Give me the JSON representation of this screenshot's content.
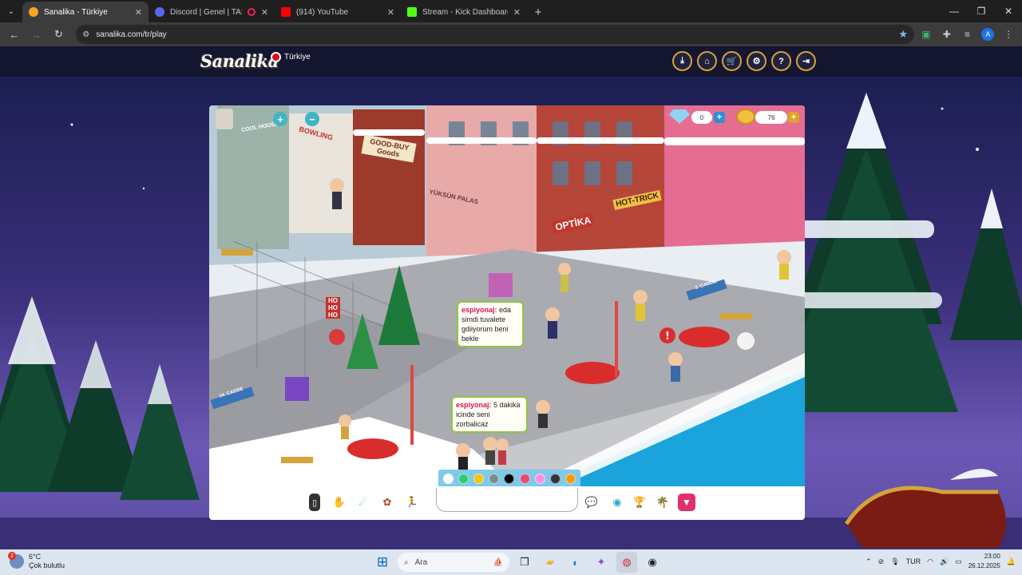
{
  "browser": {
    "tabs": [
      {
        "title": "Sanalika - Türkiye",
        "active": true,
        "fav_color": "#f6a623"
      },
      {
        "title": "Discord | Genel | TAŞACAK",
        "active": false,
        "fav_color": "#5865f2"
      },
      {
        "title": "(914) YouTube",
        "active": false,
        "fav_color": "#ff0000"
      },
      {
        "title": "Stream - Kick Dashboard",
        "active": false,
        "fav_color": "#53fc18"
      }
    ],
    "new_tab": "+",
    "url": "sanalika.com/tr/play",
    "profile_initial": "A"
  },
  "site": {
    "logo": "Sanalika",
    "region": "Türkiye",
    "header_icons": [
      "download-icon",
      "home-icon",
      "cart-icon",
      "gear-icon",
      "help-icon",
      "logout-icon"
    ],
    "header_glyphs": [
      "⤓",
      "⌂",
      "🛒",
      "⚙",
      "?",
      "⇥"
    ]
  },
  "game": {
    "diamonds": "0",
    "gold": "76",
    "plus": "+",
    "minus": "−",
    "signs": {
      "cool_house": "COOL HOUSE",
      "bowling": "BOWLING",
      "goodbuy": "GOOD-BUY Goods",
      "yuksun": "YÜKSÜN PALAS",
      "optika": "OPTİKA",
      "hottrick": "HOT-TRICK",
      "cadde3": "3. CADDE",
      "cadde14": "14. CADDE",
      "hohoho": "HO HO HO"
    },
    "chat_bubbles": [
      {
        "nick": "espiyonaj:",
        "text": "eda simdi tuvalete gdiiyorum beni bekle"
      },
      {
        "nick": "espiyonaj:",
        "text": "5 dakika icinde seni zorbalicaz"
      }
    ],
    "color_swatches": [
      "#ffffff",
      "#2ecc71",
      "#f1c40f",
      "#7f8c8d",
      "#000000",
      "#e74c6c",
      "#ff8fd8",
      "#333333",
      "#f39c12"
    ],
    "chat_placeholder": "",
    "toolbar_icons": [
      "phone-icon",
      "hands-icon",
      "dance-icon",
      "emote-icon",
      "run-icon",
      "chat-bubbles-icon",
      "globe-icon",
      "trophy-icon",
      "island-icon",
      "menu-triangle-icon"
    ]
  },
  "taskbar": {
    "temperature": "6°C",
    "weather_text": "Çok bulutlu",
    "notifications": "2",
    "search_placeholder": "Ara",
    "language": "TUR",
    "time": "23:00",
    "date": "26.12.2025"
  }
}
